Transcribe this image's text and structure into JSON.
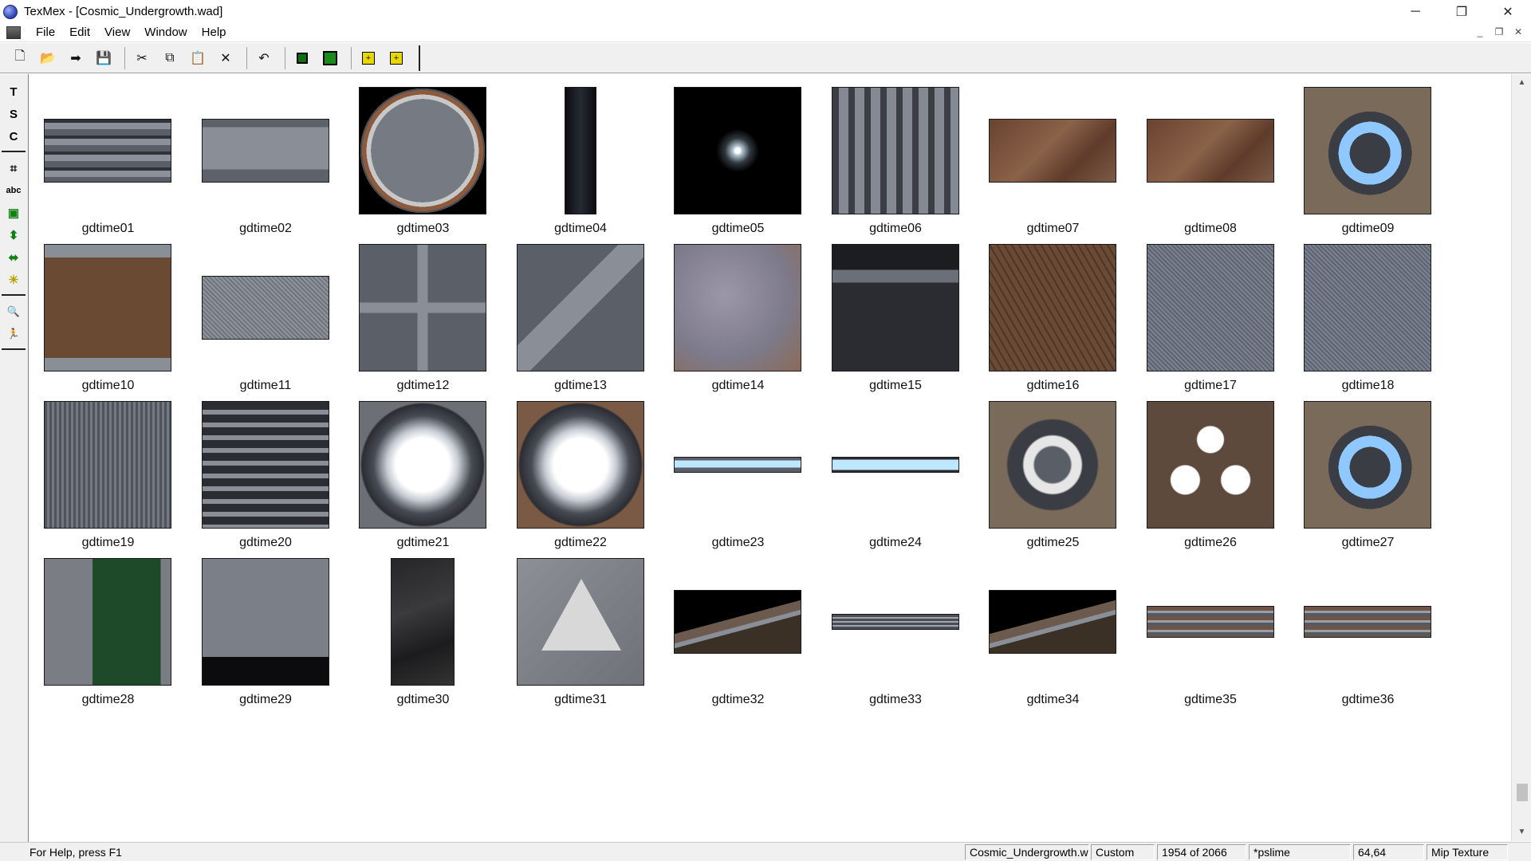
{
  "window": {
    "title": "TexMex - [Cosmic_Undergrowth.wad]",
    "minimize_glyph": "─",
    "restore_glyph": "❐",
    "close_glyph": "✕"
  },
  "menu": {
    "items": [
      "File",
      "Edit",
      "View",
      "Window",
      "Help"
    ],
    "mdi_minimize": "_",
    "mdi_restore": "❐",
    "mdi_close": "✕"
  },
  "toolbar": {
    "buttons": [
      {
        "name": "new-icon",
        "glyph": "🗋"
      },
      {
        "name": "open-icon",
        "glyph": "📂"
      },
      {
        "name": "forward-arrow-icon",
        "glyph": "➡"
      },
      {
        "name": "save-icon",
        "glyph": "💾"
      },
      {
        "name": "cut-icon",
        "glyph": "✂"
      },
      {
        "name": "copy-icon",
        "glyph": "⧉"
      },
      {
        "name": "paste-icon",
        "glyph": "📋"
      },
      {
        "name": "delete-icon",
        "glyph": "✕"
      },
      {
        "name": "undo-icon",
        "glyph": "↶"
      }
    ],
    "import_glyph": "+",
    "export_glyph": "+"
  },
  "tools": {
    "items": [
      {
        "name": "text-t-tool-icon",
        "glyph": "T"
      },
      {
        "name": "text-s-tool-icon",
        "glyph": "S"
      },
      {
        "name": "text-c-tool-icon",
        "glyph": "C"
      },
      {
        "name": "crop-tool-icon",
        "glyph": "⌗"
      },
      {
        "name": "text-abc-tool-icon",
        "glyph": "abc"
      },
      {
        "name": "layers-tool-icon",
        "glyph": "▣"
      },
      {
        "name": "vertical-flip-tool-icon",
        "glyph": "⬍"
      },
      {
        "name": "horizontal-flip-tool-icon",
        "glyph": "⬌"
      },
      {
        "name": "brightness-tool-icon",
        "glyph": "☀"
      },
      {
        "name": "zoom-tool-icon",
        "glyph": "🔍"
      },
      {
        "name": "run-tool-icon",
        "glyph": "🏃"
      }
    ]
  },
  "textures": [
    {
      "label": "gdtime01",
      "style": "horizontal-pipes",
      "w": 160,
      "h": 80
    },
    {
      "label": "gdtime02",
      "style": "metal-warning-strip",
      "w": 160,
      "h": 80
    },
    {
      "label": "gdtime03",
      "style": "round-hatch",
      "w": 160,
      "h": 160
    },
    {
      "label": "gdtime04",
      "style": "dark-pillar",
      "w": 40,
      "h": 160
    },
    {
      "label": "gdtime05",
      "style": "space-flare",
      "w": 160,
      "h": 160
    },
    {
      "label": "gdtime06",
      "style": "vent-grate",
      "w": 160,
      "h": 160
    },
    {
      "label": "gdtime07",
      "style": "rusty-panel",
      "w": 160,
      "h": 80
    },
    {
      "label": "gdtime08",
      "style": "rusty-panel",
      "w": 160,
      "h": 80
    },
    {
      "label": "gdtime09",
      "style": "blue-ring-panel",
      "w": 160,
      "h": 160
    },
    {
      "label": "gdtime10",
      "style": "rusty-frame",
      "w": 160,
      "h": 160
    },
    {
      "label": "gdtime11",
      "style": "mesh-panel",
      "w": 160,
      "h": 80
    },
    {
      "label": "gdtime12",
      "style": "cross-plate",
      "w": 160,
      "h": 160
    },
    {
      "label": "gdtime13",
      "style": "diagonal-plate",
      "w": 160,
      "h": 160
    },
    {
      "label": "gdtime14",
      "style": "worn-plate",
      "w": 160,
      "h": 160
    },
    {
      "label": "gdtime15",
      "style": "machine-face",
      "w": 160,
      "h": 160
    },
    {
      "label": "gdtime16",
      "style": "hex-rust",
      "w": 160,
      "h": 160
    },
    {
      "label": "gdtime17",
      "style": "mesh-grey",
      "w": 160,
      "h": 160
    },
    {
      "label": "gdtime18",
      "style": "mesh-grey",
      "w": 160,
      "h": 160
    },
    {
      "label": "gdtime19",
      "style": "vertical-ribs",
      "w": 160,
      "h": 160
    },
    {
      "label": "gdtime20",
      "style": "ladder-rail",
      "w": 160,
      "h": 160
    },
    {
      "label": "gdtime21",
      "style": "round-light",
      "w": 160,
      "h": 160
    },
    {
      "label": "gdtime22",
      "style": "round-light-rust",
      "w": 160,
      "h": 160
    },
    {
      "label": "gdtime23",
      "style": "light-strip",
      "w": 160,
      "h": 20
    },
    {
      "label": "gdtime24",
      "style": "light-strip-frame",
      "w": 160,
      "h": 20
    },
    {
      "label": "gdtime25",
      "style": "octagon-light",
      "w": 160,
      "h": 160
    },
    {
      "label": "gdtime26",
      "style": "octagon-triple",
      "w": 160,
      "h": 160
    },
    {
      "label": "gdtime27",
      "style": "blue-ring-panel",
      "w": 160,
      "h": 160
    },
    {
      "label": "gdtime28",
      "style": "green-console",
      "w": 160,
      "h": 160
    },
    {
      "label": "gdtime29",
      "style": "grate-console",
      "w": 160,
      "h": 160
    },
    {
      "label": "gdtime30",
      "style": "dark-rock",
      "w": 80,
      "h": 160
    },
    {
      "label": "gdtime31",
      "style": "explosion-sign",
      "w": 160,
      "h": 160
    },
    {
      "label": "gdtime32",
      "style": "stairs",
      "w": 160,
      "h": 80
    },
    {
      "label": "gdtime33",
      "style": "thin-trim",
      "w": 160,
      "h": 20
    },
    {
      "label": "gdtime34",
      "style": "stairs",
      "w": 160,
      "h": 80
    },
    {
      "label": "gdtime35",
      "style": "trim-band",
      "w": 160,
      "h": 40
    },
    {
      "label": "gdtime36",
      "style": "trim-band",
      "w": 160,
      "h": 40
    }
  ],
  "scrollbar": {
    "up_glyph": "▲",
    "down_glyph": "▼"
  },
  "status": {
    "help": "For Help, press F1",
    "file": "Cosmic_Undergrowth.w",
    "mode": "Custom",
    "position": "1954 of 2066",
    "texture_name": "*pslime",
    "size": "64,64",
    "type": "Mip Texture"
  },
  "colors": {
    "metal": "#6f737c",
    "rust": "#7a5030",
    "blue_glow": "#8ec8ff",
    "green_screen": "#1f4a2a"
  }
}
